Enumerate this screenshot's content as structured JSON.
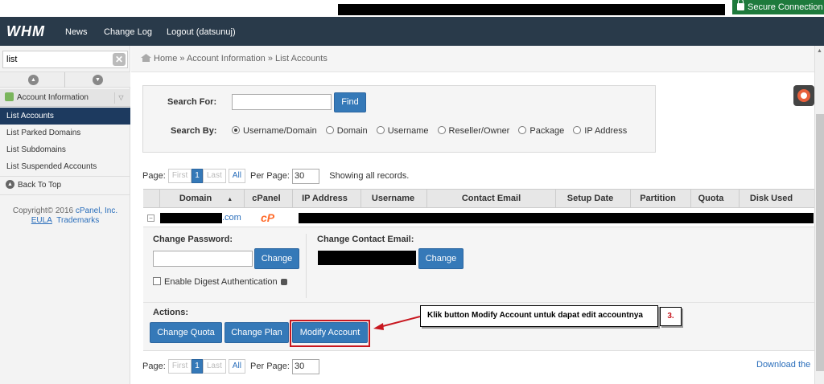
{
  "secure_connection": "Secure Connection",
  "nav": {
    "logo": "WHM",
    "links": [
      "News",
      "Change Log",
      "Logout (datsunuj)"
    ]
  },
  "sidebar": {
    "search_value": "list",
    "category": "Account Information",
    "items": [
      "List Accounts",
      "List Parked Domains",
      "List Subdomains",
      "List Suspended Accounts"
    ],
    "back_to_top": "Back To Top",
    "copyright_prefix": "Copyright© 2016 ",
    "copyright_link": "cPanel, Inc.",
    "eula": "EULA",
    "trademarks": "Trademarks"
  },
  "breadcrumb": {
    "home": "Home",
    "sep1": " » ",
    "section": "Account Information",
    "sep2": " » ",
    "current": "List Accounts"
  },
  "search": {
    "search_for_label": "Search For:",
    "find_button": "Find",
    "search_by_label": "Search By:",
    "options": [
      "Username/Domain",
      "Domain",
      "Username",
      "Reseller/Owner",
      "Package",
      "IP Address"
    ],
    "selected_index": 0
  },
  "pagination": {
    "page_label": "Page:",
    "first": "First",
    "current": "1",
    "last": "Last",
    "all": "All",
    "per_page_label": "Per Page:",
    "per_page_value": "30",
    "showing": "Showing all records."
  },
  "table": {
    "columns": [
      "Domain",
      "cPanel",
      "IP Address",
      "Username",
      "Contact Email",
      "Setup Date",
      "Partition",
      "Quota",
      "Disk Used"
    ],
    "row": {
      "domain_suffix": ".com",
      "cpanel_icon": "cP"
    }
  },
  "detail": {
    "change_password_label": "Change Password:",
    "change_button": "Change",
    "digest_auth": "Enable Digest Authentication",
    "change_email_label": "Change Contact Email:",
    "actions_label": "Actions:",
    "actions": [
      "Change Quota",
      "Change Plan",
      "Modify Account"
    ]
  },
  "annotation": {
    "callout": "Klik button Modify Account untuk dapat edit accountnya",
    "step": "3."
  },
  "download": "Download the",
  "colors": {
    "nav_bg": "#293a4a",
    "button_blue": "#3579b8",
    "secure_green": "#1e7a3c",
    "highlight_red": "#c8171f"
  }
}
